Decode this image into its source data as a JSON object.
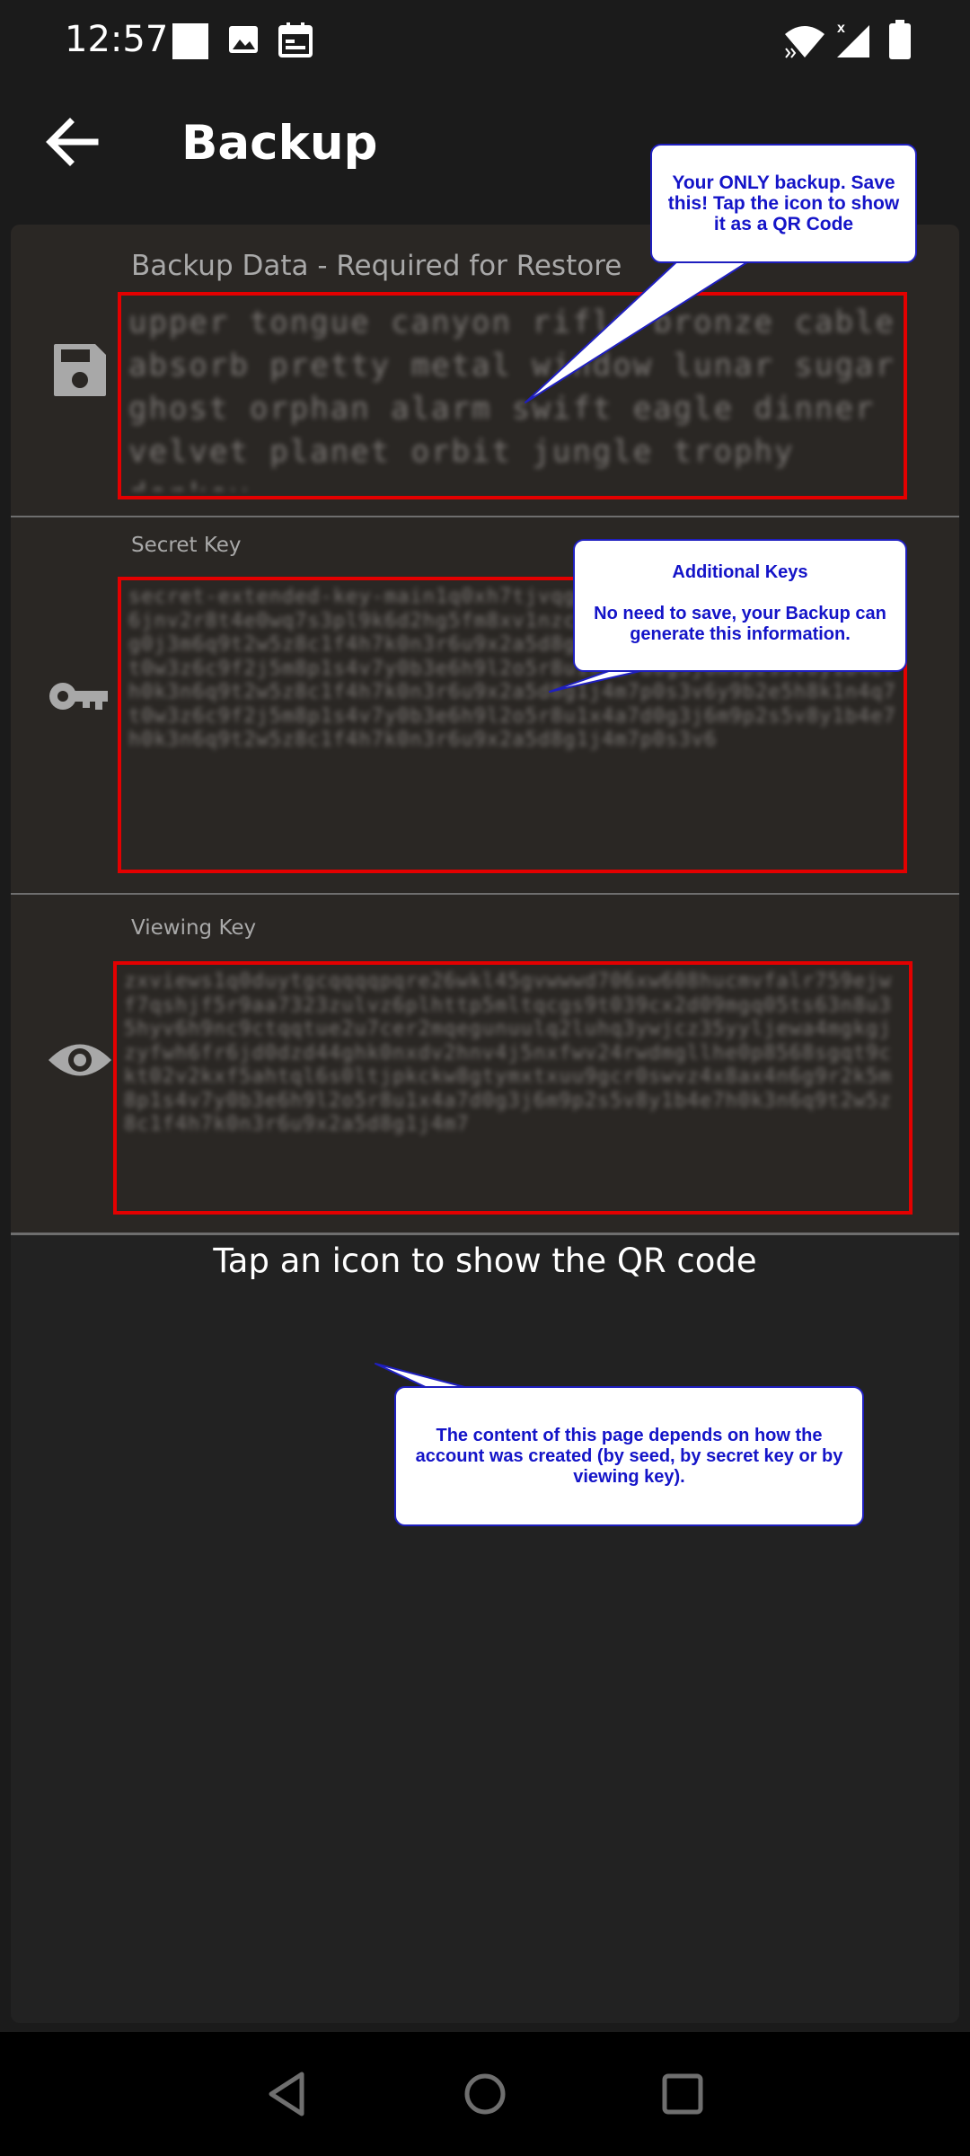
{
  "status_bar": {
    "time": "12:57",
    "left_icons": [
      "white-square-icon",
      "image-icon",
      "calendar-icon"
    ],
    "right_icons": [
      "wifi-icon",
      "cell-signal-icon",
      "battery-icon"
    ]
  },
  "app_bar": {
    "title": "Backup",
    "back_icon": "arrow-back-icon"
  },
  "sections": {
    "backup": {
      "label": "Backup Data - Required for Restore",
      "icon": "save-icon",
      "value": "upper tongue canyon rifle bronze cable absorb pretty metal window lunar sugar ghost orphan alarm swift eagle dinner velvet planet orbit jungle trophy donkey"
    },
    "secret": {
      "label": "Secret Key",
      "icon": "key-icon",
      "value": "secret-extended-key-main1q0xh7tjvqgqqpq8ln7w4x3cz2d0kqf5m9ya6jnv2r8t4e0wq7s3pl9k6d2hg5fm8xv1nzc4qj7u0ys3t6k9r2p5w8e1a4d7g0j3m6q9t2w5z8c1f4h7k0n3r6u9x2a5d8g1j4m7p0s3v6y9b2e5h8k1n4q7t0w3z6c9f2j5m8p1s4v7y0b3e6h9l2o5r8u1x4a7d0g3j6m9p2s5v8y1b4e7h0k3n6q9t2w5z8c1f4h7k0n3r6u9x2a5d8g1j4m7p0s3v6y9b2e5h8k1n4q7t0w3z6c9f2j5m8p1s4v7y0b3e6h9l2o5r8u1x4a7d0g3j6m9p2s5v8y1b4e7h0k3n6q9t2w5z8c1f4h7k0n3r6u9x2a5d8g1j4m7p0s3v6"
    },
    "viewing": {
      "label": "Viewing Key",
      "icon": "eye-icon",
      "value": "zxviews1q0duytgcqqqqpqre26wkl45gvwwwd706xw608hucmvfalr759ejwf7qshjf5r9aa7323zulvz6plhttp5mltqcgs9t039cx2d09mgq05ts63n8u35hyv6h9nc9ctqqtue2u7cer2mqegunuulq2luhq3ywjcz35yyljewa4mgkgjzyfwh6fr6jd0dzd44ghk0nxdv2hnv4j5nxfwv24rwdmgllhe0p8568sgqt9ckt02v2kxf5ahtql6s0ltjpkckw8gtymxtxuu9gcr0swvz4x8ax4n6g9r2k5m8p1s4v7y0b3e6h9l2o5r8u1x4a7d0g3j6m9p2s5v8y1b4e7h0k3n6q9t2w5z8c1f4h7k0n3r6u9x2a5d8g1j4m7"
    }
  },
  "hint": "Tap an icon to show the QR code",
  "callouts": {
    "backup": "Your ONLY backup. Save this! Tap the icon to show it as a QR Code",
    "additional_title": "Additional Keys",
    "additional_body": "No need to save, your Backup can generate this information.",
    "content": "The content of this page depends on how the account was created (by seed, by secret key or by viewing key)."
  },
  "nav_bar": {
    "icons": [
      "nav-back-icon",
      "nav-home-icon",
      "nav-recents-icon"
    ]
  },
  "colors": {
    "background": "#1b1b1b",
    "card": "#2a2724",
    "highlight_border": "#e30000",
    "callout_text": "#1414c8",
    "callout_border": "#1f1fbf"
  }
}
